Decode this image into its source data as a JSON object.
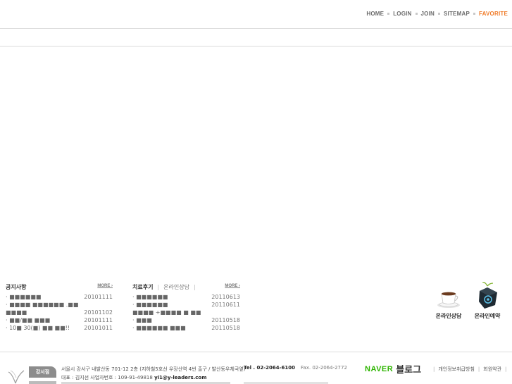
{
  "topnav": {
    "home": "HOME",
    "login": "LOGIN",
    "join": "JOIN",
    "sitemap": "SITEMAP",
    "favorite": "FAVORITE"
  },
  "notice": {
    "title": "공지사항",
    "more": "MORE ›",
    "items": [
      {
        "title": "· ■■■■■■",
        "date": "20101111"
      },
      {
        "title": "· ■■■■ ■■■■■■ .■■",
        "date": ""
      },
      {
        "title": "  ■■■■",
        "date": "20101102"
      },
      {
        "title": "· ■■/■■ ■■■",
        "date": "20101111"
      },
      {
        "title": "· 10■ 30(■) ■■ ■■!!",
        "date": "20101011"
      }
    ]
  },
  "review": {
    "title": "치료후기",
    "tab2": "온라인상담",
    "more": "MORE ›",
    "items": [
      {
        "title": "· ■■■■■■",
        "date": "20110613"
      },
      {
        "title": "· ■■■■■■",
        "date": "20110611"
      },
      {
        "title": "  ■■■■ +■■■■ ■ ■■",
        "date": ""
      },
      {
        "title": "· ■■■",
        "date": "20110518"
      },
      {
        "title": "· ■■■■■■ ■■■",
        "date": "20110518"
      }
    ]
  },
  "quick": {
    "consult": "온라인상담",
    "reserve": "온라인예약"
  },
  "footer": {
    "branch": "강서점",
    "address": "서울시 강서구 내발산동 701-12 2층 (지하철5호선 우장산역 4번 출구 / 발산동우체국옆)",
    "rep_prefix": "대표 : 김지선   사업자번호 : 109-91-49818  ",
    "email": "yi1@y-leaders.com",
    "tel": "Tel . 02-2064-6100",
    "fax": "Fax. 02-2064-2772",
    "naver": "NAVER",
    "blog": "블로그",
    "privacy": "개인정보취급방침",
    "terms": "회원약관"
  }
}
